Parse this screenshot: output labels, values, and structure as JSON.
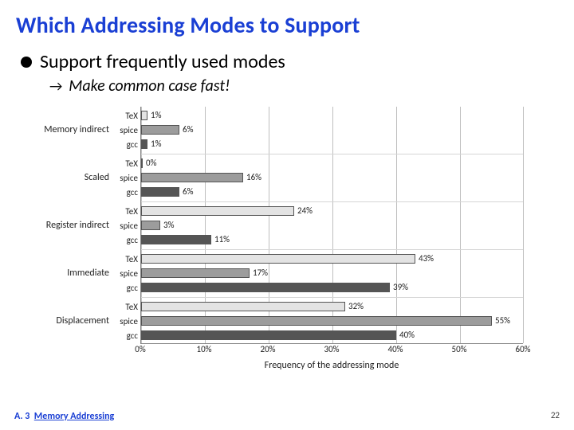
{
  "title": "Which Addressing Modes to Support",
  "bullet": "Support frequently used modes",
  "subbullet_make": "Make",
  "subbullet_rest": " common case fast!",
  "footer_section": "A. 3",
  "footer_topic": "Memory Addressing",
  "page_number": "22",
  "row_labels": [
    "TeX",
    "spice",
    "gcc"
  ],
  "xlabel": "Frequency of the addressing mode",
  "xticks": [
    "0%",
    "10%",
    "20%",
    "30%",
    "40%",
    "50%",
    "60%"
  ],
  "chart_data": {
    "type": "bar",
    "orientation": "horizontal",
    "xlabel": "Frequency of the addressing mode",
    "xlim": [
      0,
      60
    ],
    "categories": [
      "Memory indirect",
      "Scaled",
      "Register indirect",
      "Immediate",
      "Displacement"
    ],
    "series": [
      {
        "name": "TeX",
        "values": [
          1,
          0,
          24,
          43,
          32
        ]
      },
      {
        "name": "spice",
        "values": [
          6,
          16,
          3,
          17,
          55
        ]
      },
      {
        "name": "gcc",
        "values": [
          1,
          6,
          11,
          39,
          40
        ]
      }
    ],
    "value_labels": {
      "Memory indirect": [
        "1%",
        "6%",
        "1%"
      ],
      "Scaled": [
        "0%",
        "16%",
        "6%"
      ],
      "Register indirect": [
        "24%",
        "3%",
        "11%"
      ],
      "Immediate": [
        "43%",
        "17%",
        "39%"
      ],
      "Displacement": [
        "32%",
        "55%",
        "40%"
      ]
    },
    "colors": {
      "TeX": "#e3e3e3",
      "spice": "#9c9c9c",
      "gcc": "#555555"
    }
  }
}
